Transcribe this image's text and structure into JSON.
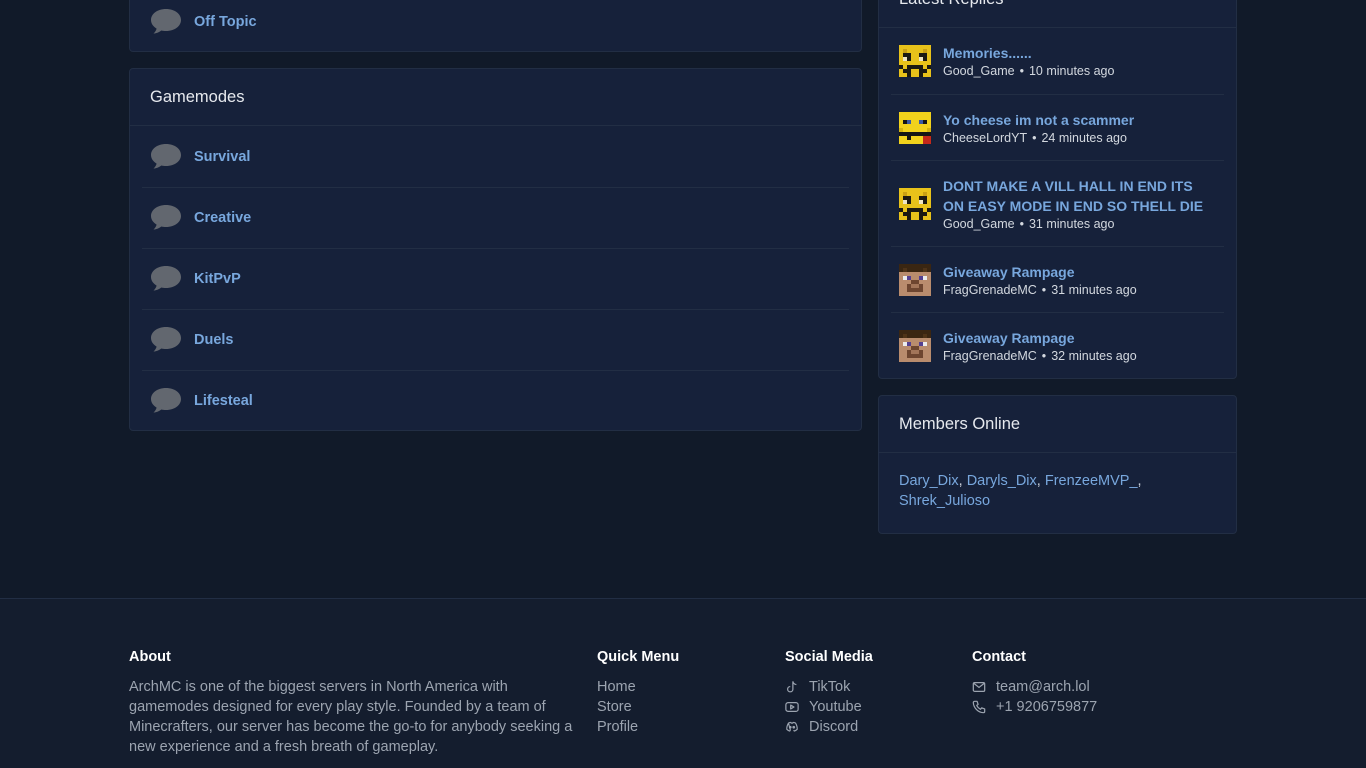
{
  "forum": {
    "off_topic": "Off Topic",
    "gamemodes": {
      "title": "Gamemodes",
      "items": [
        "Survival",
        "Creative",
        "KitPvP",
        "Duels",
        "Lifesteal"
      ]
    }
  },
  "latest_replies": {
    "title": "Latest Replies",
    "items": [
      {
        "title": "Memories......",
        "user": "Good_Game",
        "time": "10 minutes ago"
      },
      {
        "title": "Yo cheese im not a scammer",
        "user": "CheeseLordYT",
        "time": "24 minutes ago"
      },
      {
        "title": "DONT MAKE A VILL HALL IN END ITS ON EASY MODE IN END SO THELL DIE",
        "user": "Good_Game",
        "time": "31 minutes ago"
      },
      {
        "title": "Giveaway Rampage",
        "user": "FragGrenadeMC",
        "time": "31 minutes ago"
      },
      {
        "title": "Giveaway Rampage",
        "user": "FragGrenadeMC",
        "time": "32 minutes ago"
      }
    ],
    "separator": "•"
  },
  "members_online": {
    "title": "Members Online",
    "members": [
      "Dary_Dix",
      "Daryls_Dix",
      "FrenzeeMVP_",
      "Shrek_Julioso"
    ]
  },
  "footer": {
    "about": {
      "title": "About",
      "text": "ArchMC is one of the biggest servers in North America with gamemodes designed for every play style. Founded by a team of Minecrafters, our server has become the go-to for anybody seeking a new experience and a fresh breath of gameplay."
    },
    "quick_menu": {
      "title": "Quick Menu",
      "links": [
        "Home",
        "Store",
        "Profile"
      ]
    },
    "social": {
      "title": "Social Media",
      "links": [
        {
          "label": "TikTok",
          "icon": "tiktok-icon"
        },
        {
          "label": "Youtube",
          "icon": "youtube-icon"
        },
        {
          "label": "Discord",
          "icon": "discord-icon"
        }
      ]
    },
    "contact": {
      "title": "Contact",
      "email": "team@arch.lol",
      "phone": "+1 9206759877"
    }
  },
  "colors": {
    "background": "#111a29",
    "panel": "#16213a",
    "link": "#78a7dd",
    "footer": "#141d2e"
  }
}
